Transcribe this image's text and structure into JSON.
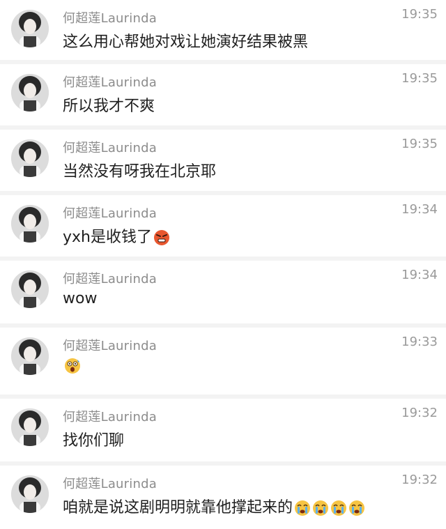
{
  "messages": [
    {
      "name": "何超莲Laurinda",
      "time": "19:35",
      "text": "这么用心帮她对戏让她演好结果被黑",
      "emojis": []
    },
    {
      "name": "何超莲Laurinda",
      "time": "19:35",
      "text": "所以我才不爽",
      "emojis": []
    },
    {
      "name": "何超莲Laurinda",
      "time": "19:35",
      "text": "当然没有呀我在北京耶",
      "emojis": []
    },
    {
      "name": "何超莲Laurinda",
      "time": "19:34",
      "text": "yxh是收钱了",
      "emojis": [
        "angry-face-emoji"
      ]
    },
    {
      "name": "何超莲Laurinda",
      "time": "19:34",
      "text": "wow",
      "emojis": []
    },
    {
      "name": "何超莲Laurinda",
      "time": "19:33",
      "text": "",
      "emojis": [
        "shocked-face-emoji"
      ]
    },
    {
      "name": "何超莲Laurinda",
      "time": "19:32",
      "text": "找你们聊",
      "emojis": []
    },
    {
      "name": "何超莲Laurinda",
      "time": "19:32",
      "text": "咱就是说这剧明明就靠他撑起来的",
      "emojis": [
        "crying-face-emoji",
        "crying-face-emoji",
        "crying-face-emoji",
        "crying-face-emoji"
      ]
    }
  ],
  "colors": {
    "background": "#f3f3f3",
    "card": "#ffffff",
    "name": "#8c8c8c",
    "time": "#9a9a9a",
    "text": "#1f1f1f",
    "emoji_yellow": "#f6c443",
    "emoji_red": "#e8572f"
  }
}
